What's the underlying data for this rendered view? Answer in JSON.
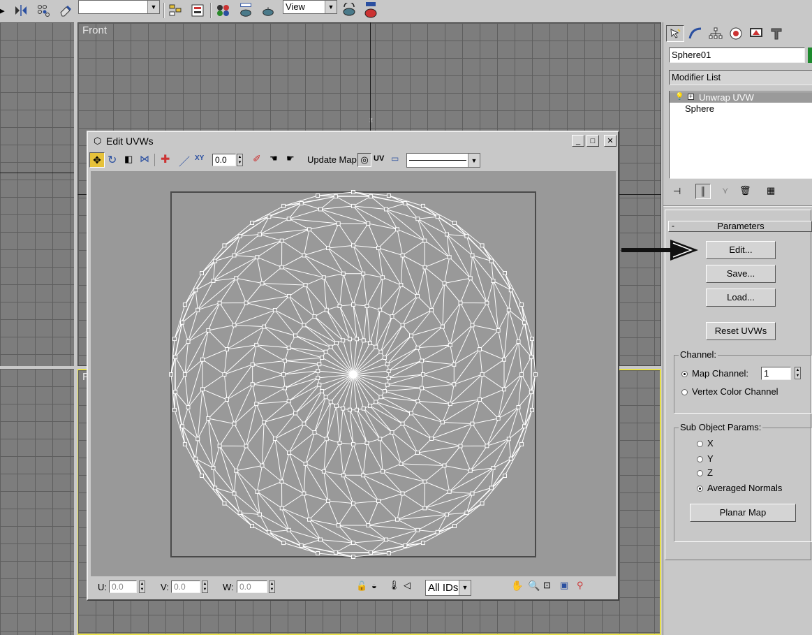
{
  "main_toolbar": {
    "named_selection_value": "",
    "view_dropdown": "View",
    "icons": [
      "mirror-icon",
      "array-icon",
      "eraser-icon",
      "layers-icon",
      "curve-editor-icon",
      "material-editor-icon",
      "render-scene-icon",
      "quick-render-icon",
      "render-last-icon",
      "active-shade-icon"
    ]
  },
  "viewports": {
    "front": {
      "label": "Front"
    },
    "perspective": {
      "label": "P"
    }
  },
  "command_panel": {
    "tabs": [
      "create-tab-icon",
      "modify-tab-icon",
      "hierarchy-tab-icon",
      "motion-tab-icon",
      "display-tab-icon",
      "utilities-tab-icon"
    ],
    "object_name": "Sphere01",
    "object_color": "#1e8a2e",
    "modifier_list_label": "Modifier List",
    "stack": [
      {
        "label": "Unwrap UVW",
        "selected": true
      },
      {
        "label": "Sphere",
        "selected": false
      }
    ],
    "rollout": {
      "toggle": "-",
      "title": "Parameters"
    },
    "buttons": {
      "edit": "Edit...",
      "save": "Save...",
      "load": "Load...",
      "reset": "Reset UVWs",
      "planar": "Planar Map"
    },
    "channel": {
      "group_label": "Channel:",
      "map_channel_label": "Map Channel:",
      "map_channel_value": "1",
      "vertex_color_label": "Vertex Color Channel",
      "selected": "map_channel"
    },
    "sub_object": {
      "group_label": "Sub Object Params:",
      "options": [
        "X",
        "Y",
        "Z",
        "Averaged Normals"
      ],
      "selected": "Averaged Normals"
    }
  },
  "dialog": {
    "title": "Edit UVWs",
    "spinner_value": "0.0",
    "update_map_label": "Update Map",
    "uv_label": "UV",
    "u_label": "U:",
    "u_value": "0.0",
    "v_label": "V:",
    "v_value": "0.0",
    "w_label": "W:",
    "w_value": "0.0",
    "filter_ids": "All IDs"
  },
  "annotation": {
    "type": "arrow",
    "points_to": "edit-button",
    "color": "#000000"
  }
}
